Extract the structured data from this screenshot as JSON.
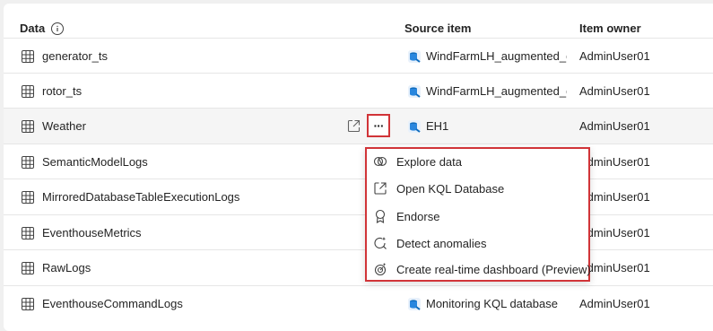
{
  "header": {
    "data_label": "Data",
    "source_label": "Source item",
    "owner_label": "Item owner"
  },
  "rows": [
    {
      "name": "generator_ts",
      "source": "WindFarmLH_augmented_de",
      "owner": "AdminUser01"
    },
    {
      "name": "rotor_ts",
      "source": "WindFarmLH_augmented_de",
      "owner": "AdminUser01"
    },
    {
      "name": "Weather",
      "source": "EH1",
      "owner": "AdminUser01"
    },
    {
      "name": "SemanticModelLogs",
      "source": "",
      "owner": "AdminUser01"
    },
    {
      "name": "MirroredDatabaseTableExecutionLogs",
      "source": "",
      "owner": "AdminUser01"
    },
    {
      "name": "EventhouseMetrics",
      "source": "",
      "owner": "AdminUser01"
    },
    {
      "name": "RawLogs",
      "source": "",
      "owner": "AdminUser01"
    },
    {
      "name": "EventhouseCommandLogs",
      "source": "Monitoring KQL database",
      "owner": "AdminUser01"
    }
  ],
  "more_button_label": "···",
  "context_menu": {
    "items": [
      {
        "label": "Explore data",
        "icon": "explore-icon"
      },
      {
        "label": "Open KQL Database",
        "icon": "open-external-icon"
      },
      {
        "label": "Endorse",
        "icon": "ribbon-icon"
      },
      {
        "label": "Detect anomalies",
        "icon": "anomaly-icon"
      },
      {
        "label": "Create real-time dashboard (Preview)",
        "icon": "dashboard-icon"
      }
    ]
  },
  "colors": {
    "highlight": "#d13438",
    "accent": "#0f6cbd"
  }
}
